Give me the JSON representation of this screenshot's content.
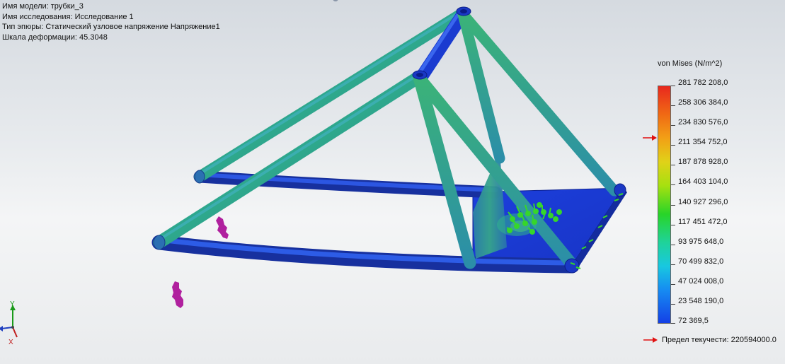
{
  "info": {
    "model_name": "Имя модели: трубки_3",
    "study_name": "Имя  исследования: Исследование 1",
    "plot_type": "Тип эпюры: Статический узловое напряжение Напряжение1",
    "deformation_scale": "Шкала деформации: 45.3048"
  },
  "legend": {
    "title": "von Mises (N/m^2)",
    "labels": [
      "281 782 208,0",
      "258 306 384,0",
      "234 830 576,0",
      "211 354 752,0",
      "187 878 928,0",
      "164 403 104,0",
      "140 927 296,0",
      "117 451 472,0",
      "93 975 648,0",
      "70 499 832,0",
      "47 024 008,0",
      "23 548 190,0",
      "72 369,5"
    ],
    "yield_strength": "Предел текучести: 220594000.0",
    "marker_color": "#e01010"
  },
  "triad": {
    "x": "X",
    "y": "Y"
  },
  "colors": {
    "low_stress": "#1a40e0",
    "mid_stress": "#2fb58a",
    "fixture": "#b0209e",
    "load": "#36d62a"
  }
}
